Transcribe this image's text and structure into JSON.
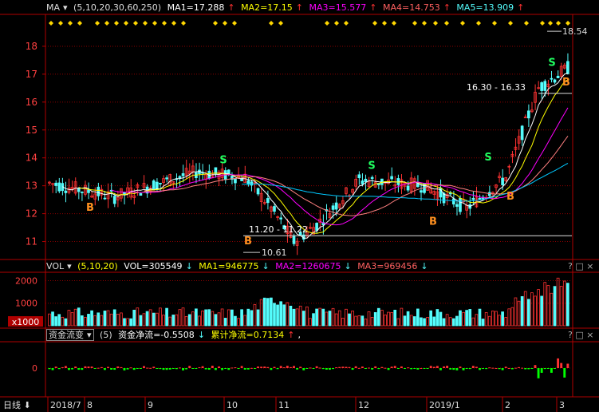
{
  "price_panel": {
    "indicator": "MA",
    "params": "(5,10,20,30,60,250)",
    "ma1": "MA1=17.288",
    "ma2": "MA2=17.15",
    "ma3": "MA3=15.577",
    "ma4": "MA4=14.753",
    "ma5": "MA5=13.909",
    "high_label": "18.54",
    "low_label": "10.61",
    "support_label": "11.20 - 11.22",
    "resistance_label": "16.30 - 16.33",
    "y_ticks": [
      "18",
      "17",
      "16",
      "15",
      "14",
      "13",
      "12",
      "11"
    ]
  },
  "volume_panel": {
    "indicator": "VOL",
    "params": "(5,10,20)",
    "vol": "VOL=305549",
    "ma1": "MA1=946775",
    "ma2": "MA2=1260675",
    "ma3": "MA3=969456",
    "y_ticks": [
      "2000",
      "1000"
    ],
    "unit": "x1000"
  },
  "flow_panel": {
    "indicator": "资金流变",
    "params": "(5)",
    "net": "资金净流=-0.5508",
    "cum": "累计净流=0.7134",
    "comma": ",",
    "y_tick": "0"
  },
  "x_axis": {
    "period": "日线",
    "labels": [
      "2018/7",
      "8",
      "9",
      "10",
      "11",
      "12",
      "2019/1",
      "2",
      "3"
    ]
  },
  "buttons": {
    "help": "?",
    "max": "□",
    "close": "×"
  },
  "colors": {
    "up": "#ff3232",
    "down": "#54fcfc",
    "ma1": "#ffffff",
    "ma2": "#ffff00",
    "ma3": "#ff00ff",
    "ma4": "#00ff00",
    "ma5": "#00c8ff",
    "ma6": "#ff8080",
    "grid": "#8b0000",
    "axis": "#b00000"
  },
  "chart_data": {
    "type": "line",
    "title": "",
    "x": [
      "2018/7",
      "8",
      "9",
      "10",
      "11",
      "12",
      "2019/1",
      "2",
      "3"
    ],
    "series": [
      {
        "name": "close",
        "values": [
          13.1,
          12.6,
          13.5,
          13.2,
          11.4,
          13.2,
          12.9,
          12.2,
          13.1,
          17.3
        ]
      }
    ],
    "ylim": [
      10.5,
      18.8
    ],
    "markers": [
      "B",
      "S",
      "B",
      "S",
      "B",
      "S",
      "B",
      "S",
      "B"
    ],
    "volume_ylim": [
      0,
      2300
    ],
    "flow_zero": 0
  }
}
